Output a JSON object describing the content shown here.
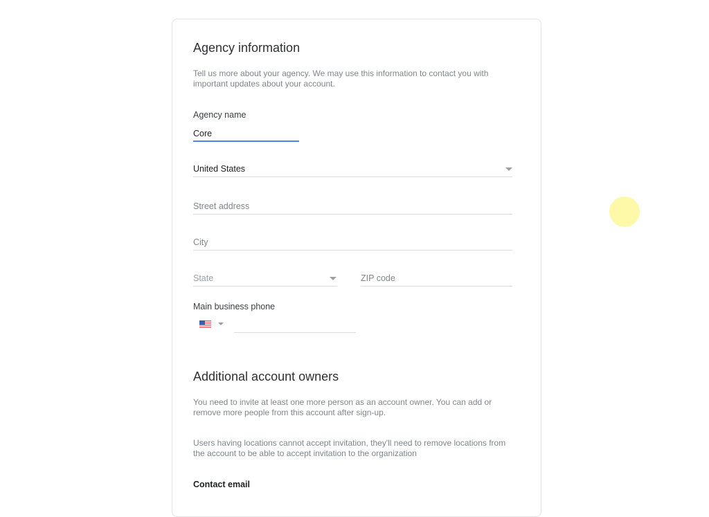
{
  "agency_section": {
    "title": "Agency information",
    "description": "Tell us more about your agency. We may use this information to contact you with important updates about your account.",
    "agency_name": {
      "label": "Agency name",
      "value": "Core"
    },
    "country": {
      "value": "United States",
      "icon": "chevron-down-icon"
    },
    "street_address": {
      "placeholder": "Street address",
      "value": ""
    },
    "city": {
      "placeholder": "City",
      "value": ""
    },
    "state": {
      "placeholder": "State",
      "icon": "chevron-down-icon"
    },
    "zip": {
      "placeholder": "ZIP code",
      "value": ""
    },
    "phone": {
      "label": "Main business phone",
      "country_flag": "us-flag-icon",
      "value": ""
    }
  },
  "owners_section": {
    "title": "Additional account owners",
    "description": "You need to invite at least one more person as an account owner. You can add or remove more people from this account after sign-up.",
    "note": "Users having locations cannot accept invitation, they'll need to remove locations from the account to be able to accept invitation to the organization",
    "contact_email_label": "Contact email"
  },
  "colors": {
    "focus_accent": "#4a86e8",
    "cursor_highlight": "#fdf58c"
  }
}
